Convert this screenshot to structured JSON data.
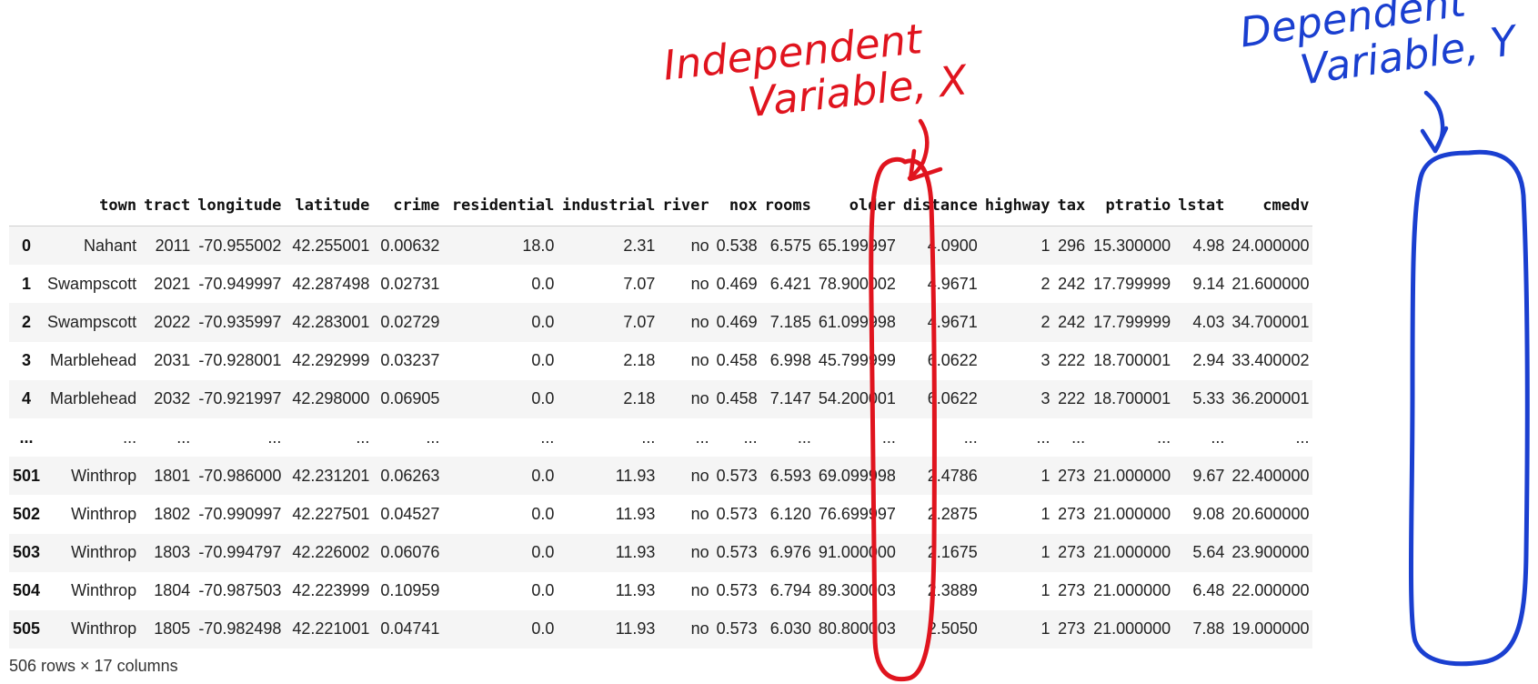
{
  "annotations": {
    "independent": {
      "line1": "Independent",
      "line2": "Variable, X",
      "color": "#e0141e",
      "target_column": "rooms"
    },
    "dependent": {
      "line1": "Dependent",
      "line2": "Variable, Y",
      "color": "#1a3fd0",
      "target_column": "cmedv"
    }
  },
  "table": {
    "columns": [
      "",
      "town",
      "tract",
      "longitude",
      "latitude",
      "crime",
      "residential",
      "industrial",
      "river",
      "nox",
      "rooms",
      "older",
      "distance",
      "highway",
      "tax",
      "ptratio",
      "lstat",
      "cmedv"
    ],
    "rows": [
      [
        "0",
        "Nahant",
        "2011",
        "-70.955002",
        "42.255001",
        "0.00632",
        "18.0",
        "2.31",
        "no",
        "0.538",
        "6.575",
        "65.199997",
        "4.0900",
        "1",
        "296",
        "15.300000",
        "4.98",
        "24.000000"
      ],
      [
        "1",
        "Swampscott",
        "2021",
        "-70.949997",
        "42.287498",
        "0.02731",
        "0.0",
        "7.07",
        "no",
        "0.469",
        "6.421",
        "78.900002",
        "4.9671",
        "2",
        "242",
        "17.799999",
        "9.14",
        "21.600000"
      ],
      [
        "2",
        "Swampscott",
        "2022",
        "-70.935997",
        "42.283001",
        "0.02729",
        "0.0",
        "7.07",
        "no",
        "0.469",
        "7.185",
        "61.099998",
        "4.9671",
        "2",
        "242",
        "17.799999",
        "4.03",
        "34.700001"
      ],
      [
        "3",
        "Marblehead",
        "2031",
        "-70.928001",
        "42.292999",
        "0.03237",
        "0.0",
        "2.18",
        "no",
        "0.458",
        "6.998",
        "45.799999",
        "6.0622",
        "3",
        "222",
        "18.700001",
        "2.94",
        "33.400002"
      ],
      [
        "4",
        "Marblehead",
        "2032",
        "-70.921997",
        "42.298000",
        "0.06905",
        "0.0",
        "2.18",
        "no",
        "0.458",
        "7.147",
        "54.200001",
        "6.0622",
        "3",
        "222",
        "18.700001",
        "5.33",
        "36.200001"
      ],
      [
        "...",
        "...",
        "...",
        "...",
        "...",
        "...",
        "...",
        "...",
        "...",
        "...",
        "...",
        "...",
        "...",
        "...",
        "...",
        "...",
        "...",
        "..."
      ],
      [
        "501",
        "Winthrop",
        "1801",
        "-70.986000",
        "42.231201",
        "0.06263",
        "0.0",
        "11.93",
        "no",
        "0.573",
        "6.593",
        "69.099998",
        "2.4786",
        "1",
        "273",
        "21.000000",
        "9.67",
        "22.400000"
      ],
      [
        "502",
        "Winthrop",
        "1802",
        "-70.990997",
        "42.227501",
        "0.04527",
        "0.0",
        "11.93",
        "no",
        "0.573",
        "6.120",
        "76.699997",
        "2.2875",
        "1",
        "273",
        "21.000000",
        "9.08",
        "20.600000"
      ],
      [
        "503",
        "Winthrop",
        "1803",
        "-70.994797",
        "42.226002",
        "0.06076",
        "0.0",
        "11.93",
        "no",
        "0.573",
        "6.976",
        "91.000000",
        "2.1675",
        "1",
        "273",
        "21.000000",
        "5.64",
        "23.900000"
      ],
      [
        "504",
        "Winthrop",
        "1804",
        "-70.987503",
        "42.223999",
        "0.10959",
        "0.0",
        "11.93",
        "no",
        "0.573",
        "6.794",
        "89.300003",
        "2.3889",
        "1",
        "273",
        "21.000000",
        "6.48",
        "22.000000"
      ],
      [
        "505",
        "Winthrop",
        "1805",
        "-70.982498",
        "42.221001",
        "0.04741",
        "0.0",
        "11.93",
        "no",
        "0.573",
        "6.030",
        "80.800003",
        "2.5050",
        "1",
        "273",
        "21.000000",
        "7.88",
        "19.000000"
      ]
    ]
  },
  "footer": "506 rows × 17 columns"
}
